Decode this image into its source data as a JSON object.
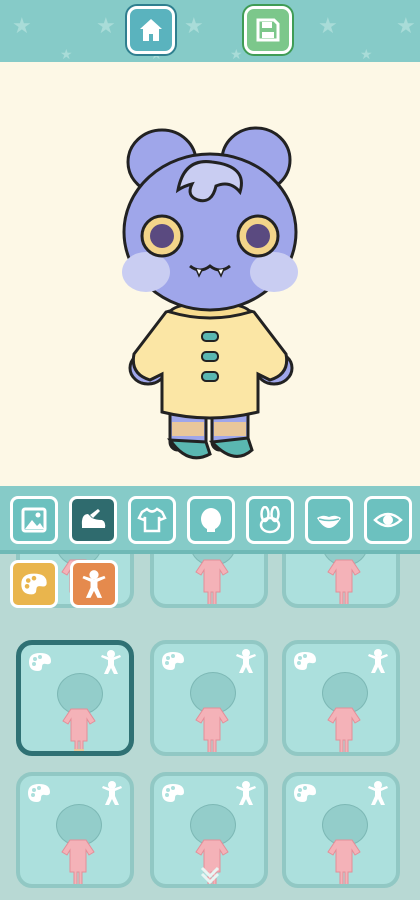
{
  "top_bar": {
    "home_icon": "home-icon",
    "save_icon": "save-icon",
    "accent": "#86cbc8"
  },
  "character": {
    "description_icon": "character-preview",
    "body_color": "#9fa6ea",
    "sweater_color": "#fbe6a5",
    "button_color": "#5ab7b1"
  },
  "categories": [
    {
      "name": "background",
      "icon": "image-icon",
      "active": false
    },
    {
      "name": "shoes",
      "icon": "shoe-icon",
      "active": true
    },
    {
      "name": "clothes",
      "icon": "shirt-icon",
      "active": false
    },
    {
      "name": "head",
      "icon": "head-icon",
      "active": false
    },
    {
      "name": "ears",
      "icon": "bunny-icon",
      "active": false
    },
    {
      "name": "mouth",
      "icon": "mouth-icon",
      "active": false
    },
    {
      "name": "eyes",
      "icon": "eye-icon",
      "active": false
    }
  ],
  "filters": [
    {
      "icon": "palette-icon",
      "color": "#e9b54d"
    },
    {
      "icon": "person-icon",
      "color": "#e58a4d"
    }
  ],
  "items": [
    {
      "row": 0,
      "col": 0,
      "selected": false
    },
    {
      "row": 0,
      "col": 1,
      "selected": false
    },
    {
      "row": 0,
      "col": 2,
      "selected": false
    },
    {
      "row": 1,
      "col": 0,
      "selected": true
    },
    {
      "row": 1,
      "col": 1,
      "selected": false
    },
    {
      "row": 1,
      "col": 2,
      "selected": false
    },
    {
      "row": 2,
      "col": 0,
      "selected": false
    },
    {
      "row": 2,
      "col": 1,
      "selected": false
    },
    {
      "row": 2,
      "col": 2,
      "selected": false
    }
  ]
}
